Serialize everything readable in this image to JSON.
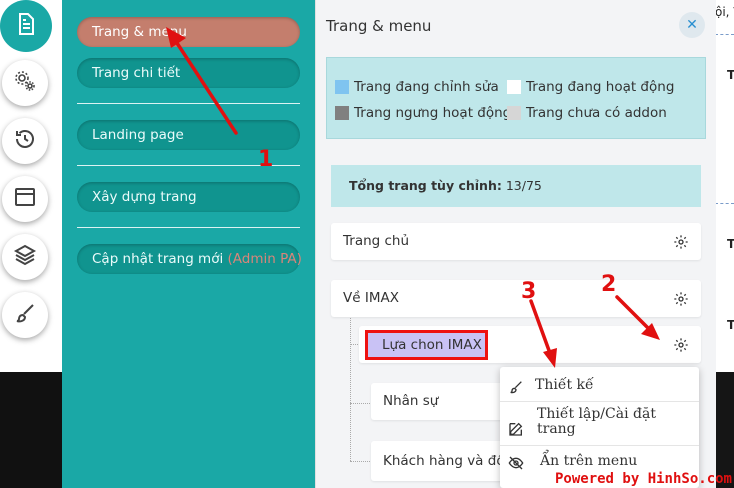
{
  "background": {
    "fragment_top": "ội, V",
    "fragment_t1": "T",
    "fragment_t2": "T",
    "fragment_t3": "T"
  },
  "rail": {
    "items": [
      {
        "icon": "document-icon",
        "active": true
      },
      {
        "icon": "gears-icon"
      },
      {
        "icon": "history-icon"
      },
      {
        "icon": "layout-icon"
      },
      {
        "icon": "layers-icon"
      },
      {
        "icon": "brush-icon"
      }
    ]
  },
  "menu": {
    "items": [
      {
        "label": "Trang & menu"
      },
      {
        "label": "Trang chi tiết"
      },
      {
        "label": "Landing page"
      },
      {
        "label": "Xây dựng trang"
      },
      {
        "label": "Cập nhật trang mới",
        "suffix": "(Admin PA)"
      }
    ]
  },
  "panel": {
    "title": "Trang & menu",
    "close_icon": "close-icon",
    "legend": [
      {
        "label": "Trang đang chỉnh sửa",
        "color": "#7fc4f0"
      },
      {
        "label": "Trang đang hoạt động",
        "color": "#ffffff"
      },
      {
        "label": "Trang ngưng hoạt động",
        "color": "#808080"
      },
      {
        "label": "Trang chưa có addon",
        "color": "#d6d6d6"
      }
    ],
    "summary_label": "Tổng trang tùy chỉnh:",
    "summary_value": "13/75",
    "pages": [
      {
        "label": "Trang chủ"
      },
      {
        "label": "Về IMAX"
      },
      {
        "label": "Lựa chon IMAX"
      },
      {
        "label": "Nhân sự"
      },
      {
        "label": "Khách hàng và đối t"
      }
    ],
    "dropdown": [
      {
        "label": "Thiết kế",
        "icon": "brush-icon"
      },
      {
        "label": "Thiết lập/Cài đặt trang",
        "icon": "edit-icon"
      },
      {
        "label": "Ẩn trên menu",
        "icon": "eye-slash-icon"
      }
    ]
  },
  "annotations": {
    "n1": "1",
    "n2": "2",
    "n3": "3"
  },
  "watermark": "Powered by HinhSo.com",
  "colors": {
    "teal": "#1aa8a6",
    "active_menu": "#c47e6d",
    "annotation_red": "#e01010"
  }
}
